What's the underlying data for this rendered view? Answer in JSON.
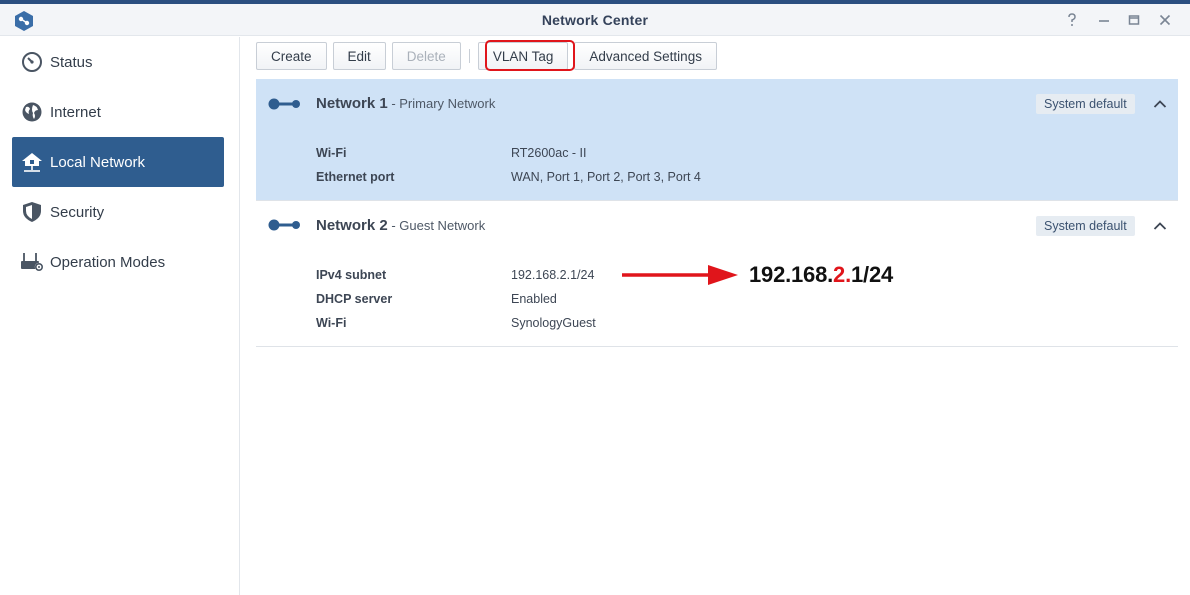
{
  "window": {
    "title": "Network Center",
    "controls": [
      "help-icon",
      "minimize-icon",
      "maximize-icon",
      "close-icon"
    ]
  },
  "sidebar": {
    "items": [
      {
        "label": "Status",
        "icon": "gauge-icon",
        "active": false
      },
      {
        "label": "Internet",
        "icon": "globe-icon",
        "active": false
      },
      {
        "label": "Local Network",
        "icon": "home-network-icon",
        "active": true
      },
      {
        "label": "Security",
        "icon": "shield-icon",
        "active": false
      },
      {
        "label": "Operation Modes",
        "icon": "router-gear-icon",
        "active": false
      }
    ]
  },
  "toolbar": {
    "create": "Create",
    "edit": "Edit",
    "delete": "Delete",
    "vlan_tag": "VLAN Tag",
    "advanced_settings": "Advanced Settings"
  },
  "networks": [
    {
      "name": "Network 1",
      "subtitle": " - Primary Network",
      "badge": "System default",
      "selected": true,
      "fields": [
        {
          "label": "Wi-Fi",
          "value": "RT2600ac - II"
        },
        {
          "label": "Ethernet port",
          "value": "WAN, Port 1, Port 2, Port 3, Port 4"
        }
      ]
    },
    {
      "name": "Network 2",
      "subtitle": " - Guest Network",
      "badge": "System default",
      "selected": false,
      "fields": [
        {
          "label": "IPv4 subnet",
          "value": "192.168.2.1/24"
        },
        {
          "label": "DHCP server",
          "value": "Enabled"
        },
        {
          "label": "Wi-Fi",
          "value": "SynologyGuest"
        }
      ]
    }
  ],
  "annotation": {
    "prefix": "192.168.",
    "highlight": "2.",
    "suffix": "1/24"
  },
  "colors": {
    "accent": "#2f5d8f",
    "selected_row": "#cfe2f6",
    "annotation_red": "#e0151b"
  }
}
